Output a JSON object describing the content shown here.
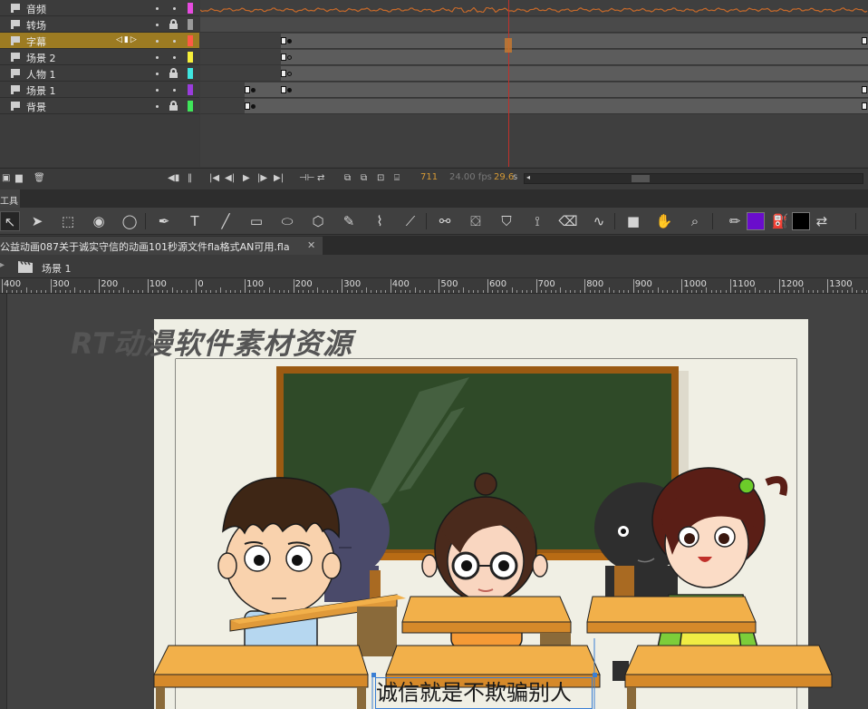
{
  "layers": [
    {
      "name": "音频",
      "color": "#e74be0",
      "locked": false,
      "selected": false
    },
    {
      "name": "转场",
      "color": "#9a9a9a",
      "locked": true,
      "selected": false
    },
    {
      "name": "字幕",
      "color": "#ff5a46",
      "locked": false,
      "selected": true
    },
    {
      "name": "场景 2",
      "color": "#f6ef3a",
      "locked": false,
      "selected": false
    },
    {
      "name": "人物 1",
      "color": "#3fe6e0",
      "locked": true,
      "selected": false
    },
    {
      "name": "场景 1",
      "color": "#9a3cdc",
      "locked": false,
      "selected": false
    },
    {
      "name": "背景",
      "color": "#3fe65a",
      "locked": true,
      "selected": false
    }
  ],
  "timeline": {
    "current_frame": "711",
    "fps": "24.00 fps",
    "time": "29.6",
    "time_unit": "s"
  },
  "tools_panel_label": "工具",
  "document": {
    "tab_title": "公益动画087关于诚实守信的动画101秒源文件fla格式AN可用.fla",
    "close_glyph": "✕",
    "scene_label": "场景 1"
  },
  "ruler_labels": [
    "400",
    "300",
    "200",
    "100",
    "0",
    "100",
    "200",
    "300",
    "400",
    "500",
    "600",
    "700",
    "800",
    "900",
    "1000",
    "1100",
    "1200",
    "1300"
  ],
  "stage": {
    "watermark": "RT动漫软件素材资源",
    "subtitle": "诚信就是不欺骗别人"
  },
  "colors": {
    "fill": "#6a0dcc",
    "stroke": "#000000",
    "selected_layer": "#9c7b22",
    "playhead": "#c0302a"
  }
}
